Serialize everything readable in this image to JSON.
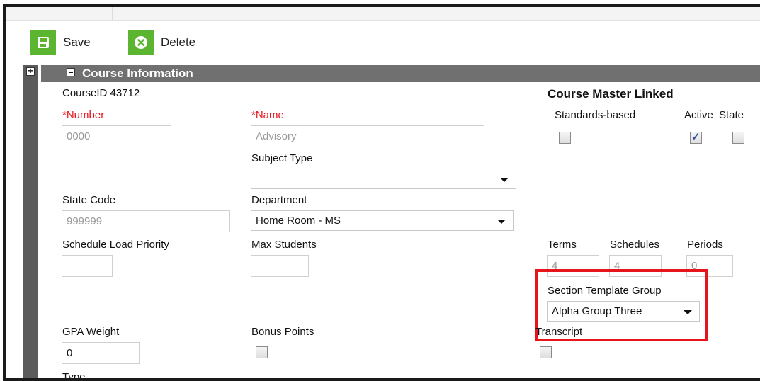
{
  "toolbar": {
    "save_label": "Save",
    "delete_label": "Delete"
  },
  "section": {
    "title": "Course Information"
  },
  "course": {
    "id_label": "CourseID 43712",
    "master_linked": "Course Master Linked"
  },
  "fields": {
    "number": {
      "label": "*Number",
      "value": "0000"
    },
    "name": {
      "label": "*Name",
      "value": "Advisory"
    },
    "subject_type": {
      "label": "Subject Type",
      "value": ""
    },
    "state_code": {
      "label": "State Code",
      "value": "999999"
    },
    "department": {
      "label": "Department",
      "value": "Home Room - MS"
    },
    "schedule_load_priority": {
      "label": "Schedule Load Priority",
      "value": ""
    },
    "max_students": {
      "label": "Max Students",
      "value": ""
    },
    "standards_based": {
      "label": "Standards-based",
      "checked": "false"
    },
    "active": {
      "label": "Active",
      "checked": "true"
    },
    "state": {
      "label": "State",
      "checked": "false"
    },
    "terms": {
      "label": "Terms",
      "value": "4"
    },
    "schedules": {
      "label": "Schedules",
      "value": "4"
    },
    "periods": {
      "label": "Periods",
      "value": "0"
    },
    "section_template_group": {
      "label": "Section Template Group",
      "value": "Alpha Group Three"
    },
    "gpa_weight": {
      "label": "GPA Weight",
      "value": "0"
    },
    "bonus_points": {
      "label": "Bonus Points",
      "checked": "false"
    },
    "transcript": {
      "label": "Transcript",
      "checked": "false"
    },
    "type": {
      "label": "Type"
    }
  },
  "colors": {
    "accent": "#5cb531",
    "header": "#707070",
    "required": "#e8151c",
    "highlight": "#e8141c"
  }
}
